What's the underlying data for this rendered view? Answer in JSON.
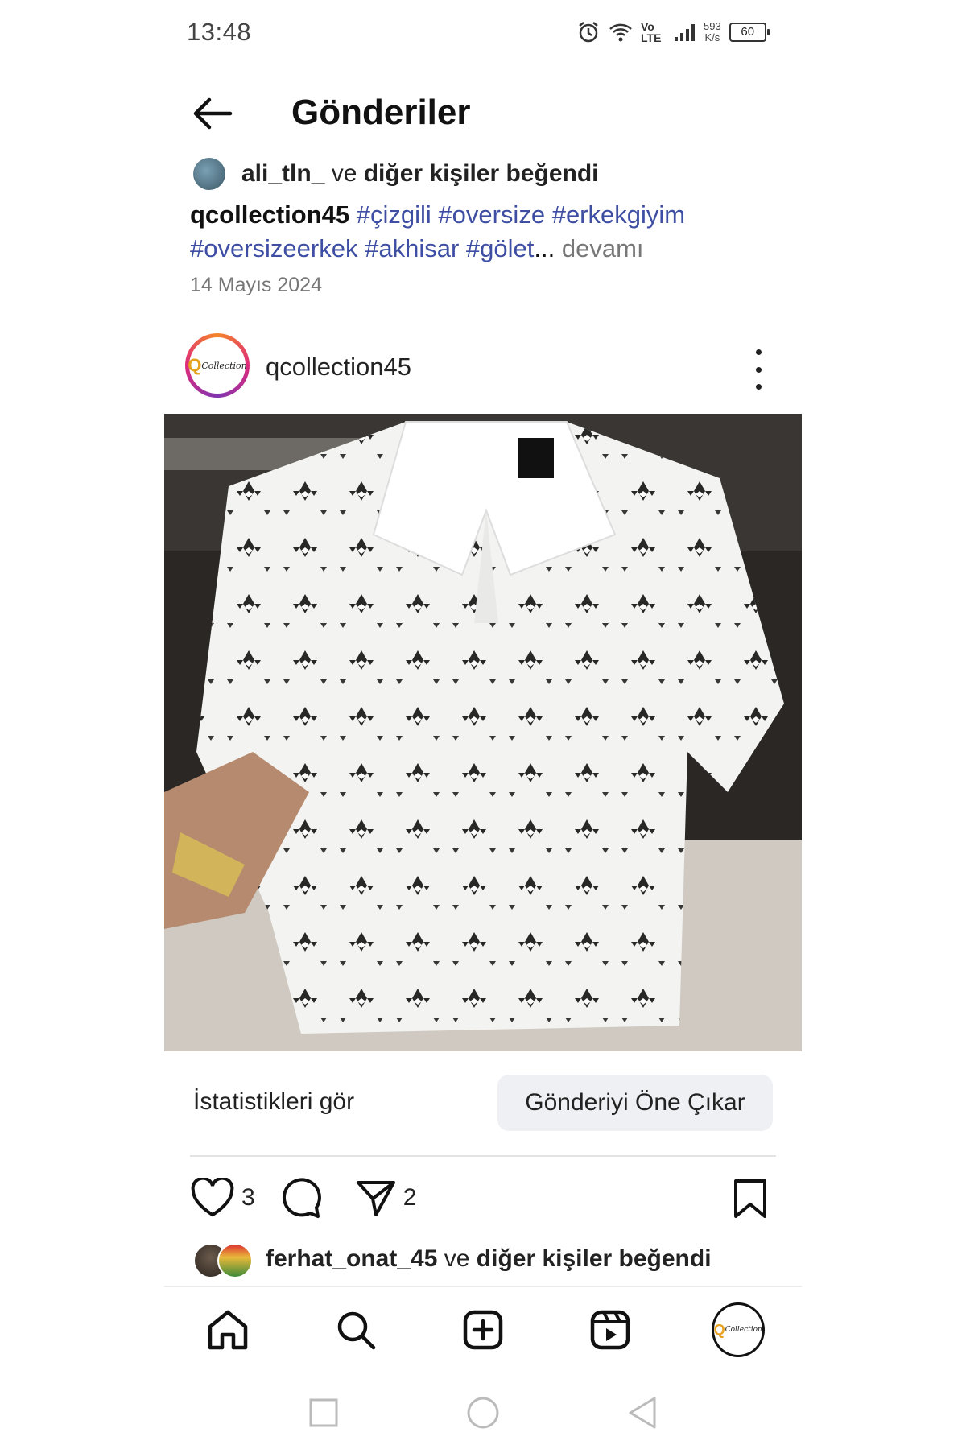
{
  "status_bar": {
    "time": "13:48",
    "network_speed_value": "593",
    "network_speed_unit": "K/s",
    "volte": "Vo LTE",
    "battery": "60"
  },
  "header": {
    "title": "Gönderiler"
  },
  "post_meta": {
    "liked_by_user": "ali_tln_",
    "liked_by_suffix": " ve ",
    "liked_by_others": "diğer kişiler beğendi",
    "caption_user": "qcollection45",
    "hashtags": [
      "#çizgili",
      "#oversize",
      "#erkekgiyim",
      "#oversizeerkek",
      "#akhisar",
      "#gölet"
    ],
    "ellipsis": "...",
    "more_label": "devamı",
    "date": "14 Mayıs 2024"
  },
  "post": {
    "username": "qcollection45",
    "logo_text": "Collection",
    "logo_letter": "Q",
    "stats_label": "İstatistikleri gör",
    "boost_label": "Gönderiyi Öne Çıkar",
    "like_count": "3",
    "share_count": "2",
    "liked_by_user": "ferhat_onat_45",
    "liked_by_suffix": " ve ",
    "liked_by_others": "diğer kişiler beğendi"
  },
  "icons": {
    "back": "arrow-left-icon",
    "like": "heart-icon",
    "comment": "comment-icon",
    "share": "send-icon",
    "save": "bookmark-icon",
    "home": "home-icon",
    "search": "search-icon",
    "create": "plus-square-icon",
    "reels": "reels-icon"
  },
  "colors": {
    "hashtag": "#3d4ea3",
    "boost_bg": "#eff0f4",
    "logo_accent": "#e6a11e"
  }
}
